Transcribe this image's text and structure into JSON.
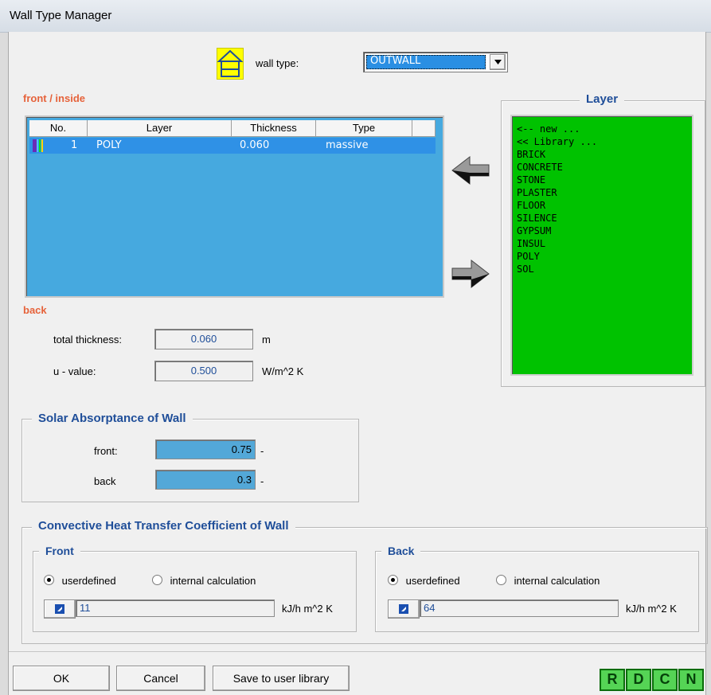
{
  "window": {
    "title": "Wall Type Manager"
  },
  "header": {
    "wall_type_label": "wall type:",
    "wall_type_value": "OUTWALL"
  },
  "layers_table": {
    "front_label": "front / inside",
    "back_label": "back",
    "columns": [
      "No.",
      "Layer",
      "Thickness",
      "Type"
    ],
    "rows": [
      {
        "no": "1",
        "layer": "POLY",
        "thickness": "0.060",
        "type": "massive"
      }
    ]
  },
  "layer_library": {
    "title": "Layer",
    "items": [
      "<-- new ...",
      "<< Library ...",
      "BRICK",
      "CONCRETE",
      "STONE",
      "PLASTER",
      "FLOOR",
      "SILENCE",
      "GYPSUM",
      "INSUL",
      "POLY",
      "SOL"
    ]
  },
  "totals": {
    "thickness_label": "total thickness:",
    "thickness_value": "0.060",
    "thickness_unit": "m",
    "u_label": "u - value:",
    "u_value": "0.500",
    "u_unit": "W/m^2 K"
  },
  "solar": {
    "title": "Solar Absorptance of Wall",
    "front_label": "front:",
    "front_value": "0.75",
    "front_unit": "-",
    "back_label": "back",
    "back_value": "0.3",
    "back_unit": "-"
  },
  "convective": {
    "title": "Convective Heat Transfer Coefficient of Wall",
    "front": {
      "title": "Front",
      "opt_user": "userdefined",
      "opt_internal": "internal calculation",
      "selected": "userdefined",
      "value": "11",
      "unit": "kJ/h m^2 K"
    },
    "back": {
      "title": "Back",
      "opt_user": "userdefined",
      "opt_internal": "internal calculation",
      "selected": "userdefined",
      "value": "64",
      "unit": "kJ/h m^2 K"
    }
  },
  "buttons": {
    "ok": "OK",
    "cancel": "Cancel",
    "save": "Save to user library"
  },
  "toolbar_right": [
    "R",
    "D",
    "C",
    "N"
  ],
  "colors": {
    "accent_blue": "#1f4e99",
    "section_red": "#e6623a",
    "list_blue": "#46a9df",
    "library_green": "#00c200"
  }
}
